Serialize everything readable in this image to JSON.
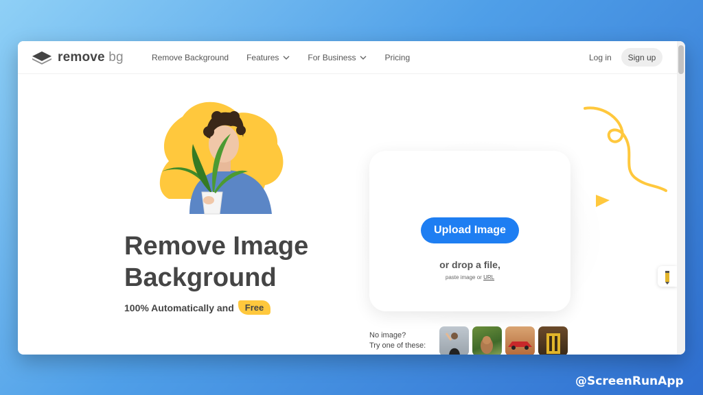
{
  "brand": {
    "name": "remove",
    "suffix": "bg"
  },
  "nav": {
    "items": [
      {
        "label": "Remove Background",
        "has_dropdown": false
      },
      {
        "label": "Features",
        "has_dropdown": true
      },
      {
        "label": "For Business",
        "has_dropdown": true
      },
      {
        "label": "Pricing",
        "has_dropdown": false
      }
    ],
    "login": "Log in",
    "signup": "Sign up"
  },
  "hero": {
    "headline_line1": "Remove Image",
    "headline_line2": "Background",
    "subline": "100% Automatically and",
    "free_tag": "Free"
  },
  "upload": {
    "button": "Upload Image",
    "drop_text": "or drop a file,",
    "paste_prefix": "paste image or",
    "paste_link": "URL"
  },
  "samples": {
    "line1": "No image?",
    "line2": "Try one of these:",
    "thumbnails": [
      "person",
      "animal",
      "car",
      "object"
    ]
  },
  "watermark": "@ScreenRunApp",
  "colors": {
    "accent": "#1e7ef2",
    "yellow": "#ffc83d",
    "text": "#454545"
  }
}
